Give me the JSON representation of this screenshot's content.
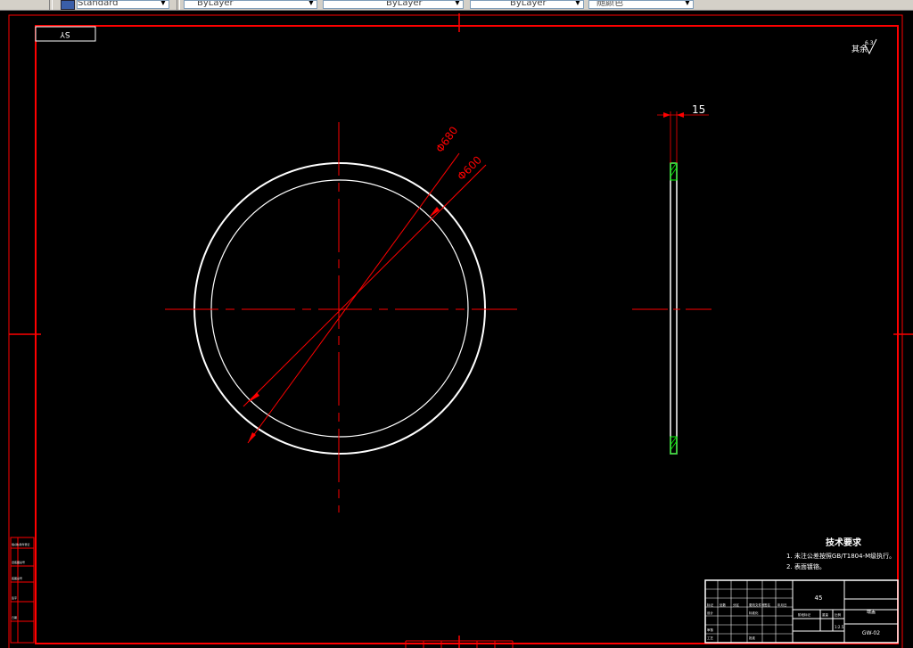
{
  "toolbar": {
    "text_style": "Standard",
    "layer_color": "ByLayer",
    "layer_linetype": "ByLayer",
    "layer_lineweight": "ByLayer",
    "plot_style": "随颜色"
  },
  "drawing": {
    "corner_label": "SY",
    "roughness_note": "其余",
    "roughness_value": "6.3",
    "dim_outer": "Φ680",
    "dim_inner": "Φ600",
    "dim_thickness": "15"
  },
  "tech_requirements": {
    "title": "技术要求",
    "items": [
      "1. 未注公差按照GB/T1804-M级执行。",
      "2. 表面镀铬。"
    ]
  },
  "title_block": {
    "material": "45",
    "part_name": "端盖",
    "drawing_no": "GW-02",
    "scale": "1:2.5",
    "labels": [
      "标记",
      "处数",
      "分区",
      "更改文件号",
      "签名",
      "年月日",
      "设计",
      "标准化",
      "阶段标记",
      "重量",
      "比例",
      "审核",
      "工艺",
      "批准"
    ]
  },
  "side_table": {
    "rows": [
      "借(通)用件登记",
      "旧底图总号",
      "底图总号",
      "签字",
      "日期"
    ]
  },
  "colors": {
    "frame": "#ff0000",
    "geometry": "#ffffff",
    "hatch": "#00ff00",
    "background": "#000000",
    "toolbar": "#d4d0c8"
  }
}
